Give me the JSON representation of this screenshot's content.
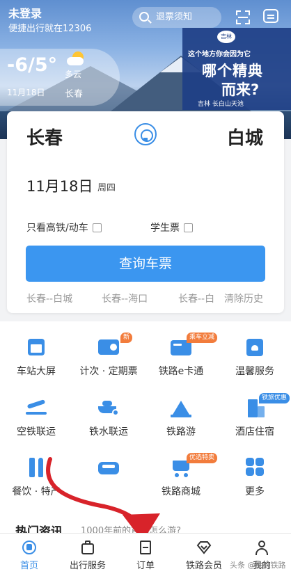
{
  "header": {
    "login_status": "未登录",
    "tagline": "便捷出行就在12306",
    "search_placeholder": "退票须知"
  },
  "weather": {
    "temperature": "-6/5°",
    "condition": "多云",
    "date": "11月18日",
    "city": "长春"
  },
  "banner": {
    "logo": "吉林",
    "line1": "这个地方你会因为它",
    "line2": "哪个精典",
    "line3": "而来?",
    "footer": "吉林   长白山天池"
  },
  "booking": {
    "from_station": "长春",
    "to_station": "白城",
    "date": "11月18日",
    "weekday": "周四",
    "option_highspeed": "只看高铁/动车",
    "option_student": "学生票",
    "query_button": "查询车票",
    "history": [
      "长春--白城",
      "长春--海口",
      "长春--白"
    ],
    "clear_history": "清除历史"
  },
  "services": [
    {
      "label": "车站大屏",
      "icon": "station-screen-icon"
    },
    {
      "label": "计次 · 定期票",
      "icon": "ticket-card-icon",
      "badge": "新"
    },
    {
      "label": "铁路e卡通",
      "icon": "e-card-icon",
      "badge": "乘车立减"
    },
    {
      "label": "温馨服务",
      "icon": "care-service-icon"
    },
    {
      "label": "空铁联运",
      "icon": "plane-train-icon"
    },
    {
      "label": "铁水联运",
      "icon": "ship-train-icon"
    },
    {
      "label": "铁路游",
      "icon": "mountain-travel-icon"
    },
    {
      "label": "酒店住宿",
      "icon": "hotel-icon",
      "badge": "铁旅优惠"
    },
    {
      "label": "餐饮 · 特产",
      "icon": "dining-icon"
    },
    {
      "label": "汽车",
      "icon": "car-icon"
    },
    {
      "label": "铁路商城",
      "icon": "shopping-cart-icon",
      "badge": "优选特卖"
    },
    {
      "label": "更多",
      "icon": "more-grid-icon"
    }
  ],
  "news": {
    "title": "热门资讯",
    "subtitle": "1000年前的首都怎么游?"
  },
  "bottom_nav": [
    {
      "label": "首页",
      "icon": "home-train-icon",
      "active": true
    },
    {
      "label": "出行服务",
      "icon": "luggage-icon",
      "active": false
    },
    {
      "label": "订单",
      "icon": "order-doc-icon",
      "active": false
    },
    {
      "label": "铁路会员",
      "icon": "diamond-icon",
      "active": false
    },
    {
      "label": "我的",
      "icon": "user-icon",
      "active": false
    }
  ],
  "watermark": "头条 @桃桃铁路",
  "colors": {
    "primary_blue": "#3b96f0",
    "badge_orange": "#f27c3c",
    "annotation_red": "#d8232a"
  }
}
